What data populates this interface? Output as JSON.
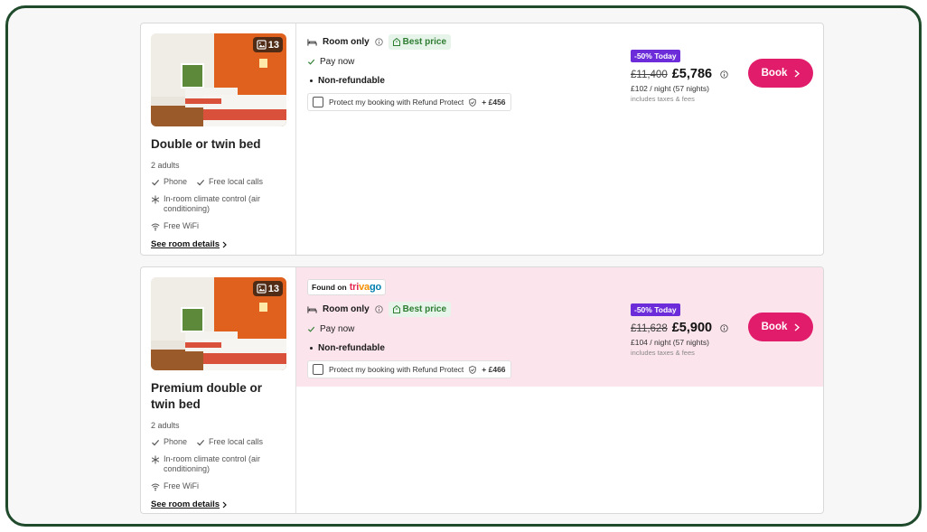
{
  "rooms": [
    {
      "photo_count": "13",
      "name": "Double or twin bed",
      "occupancy": "2 adults",
      "amenities": {
        "phone": "Phone",
        "local_calls": "Free local calls",
        "climate": "In-room climate control (air conditioning)",
        "wifi": "Free WiFi"
      },
      "see_details": "See room details",
      "offer": {
        "found_on": "",
        "board": "Room only",
        "best_price": "Best price",
        "payment": "Pay now",
        "refund": "Non-refundable",
        "protect_text": "Protect my booking with Refund Protect",
        "protect_amount": "+ £456",
        "promo": "-50% Today",
        "old_price": "£11,400",
        "new_price": "£5,786",
        "per_night": "£102 / night  (57 nights)",
        "taxes": "includes taxes & fees",
        "book_label": "Book"
      }
    },
    {
      "photo_count": "13",
      "name": "Premium double or twin bed",
      "occupancy": "2 adults",
      "amenities": {
        "phone": "Phone",
        "local_calls": "Free local calls",
        "climate": "In-room climate control (air conditioning)",
        "wifi": "Free WiFi"
      },
      "see_details": "See room details",
      "offer": {
        "found_on": "Found on",
        "found_on_brand": [
          "tri",
          "va",
          "go"
        ],
        "board": "Room only",
        "best_price": "Best price",
        "payment": "Pay now",
        "refund": "Non-refundable",
        "protect_text": "Protect my booking with Refund Protect",
        "protect_amount": "+ £466",
        "promo": "-50% Today",
        "old_price": "£11,628",
        "new_price": "£5,900",
        "per_night": "£104 / night  (57 nights)",
        "taxes": "includes taxes & fees",
        "book_label": "Book"
      }
    }
  ],
  "colors": {
    "frame_border": "#1f4a2c",
    "book_button": "#e11d6b",
    "promo_badge": "#6c2cd9",
    "best_price_bg": "#e6f4ea",
    "highlight_offer_bg": "#fce4ec"
  }
}
